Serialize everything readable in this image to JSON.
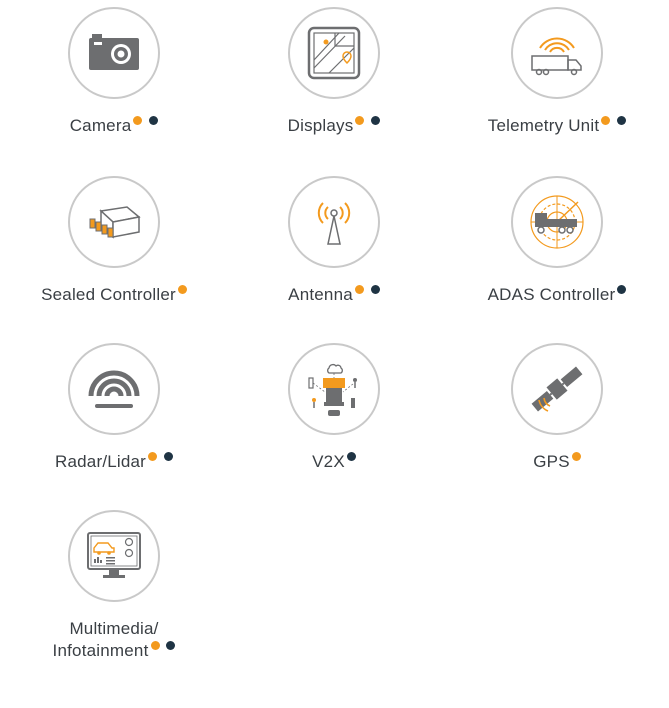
{
  "colors": {
    "orange": "#f39a1e",
    "navy": "#1f3444",
    "gray": "#6d6e70",
    "ring": "#c9c9c9"
  },
  "items": [
    {
      "label": "Camera",
      "icon": "camera-icon",
      "dots": [
        "orange",
        "navy"
      ]
    },
    {
      "label": "Displays",
      "icon": "map-display-icon",
      "dots": [
        "orange",
        "navy"
      ]
    },
    {
      "label": "Telemetry Unit",
      "icon": "telemetry-truck-icon",
      "dots": [
        "orange",
        "navy"
      ]
    },
    {
      "label": "Sealed Controller",
      "icon": "sealed-controller-icon",
      "dots": [
        "orange"
      ]
    },
    {
      "label": "Antenna",
      "icon": "antenna-icon",
      "dots": [
        "orange",
        "navy"
      ]
    },
    {
      "label": "ADAS Controller",
      "icon": "adas-truck-radar-icon",
      "dots": [
        "navy"
      ]
    },
    {
      "label": "Radar/Lidar",
      "icon": "radar-icon",
      "dots": [
        "orange",
        "navy"
      ]
    },
    {
      "label": "V2X",
      "icon": "v2x-icon",
      "dots": [
        "navy"
      ]
    },
    {
      "label": "GPS",
      "icon": "satellite-icon",
      "dots": [
        "orange"
      ]
    },
    {
      "label_line1": "Multimedia/",
      "label_line2": "Infotainment",
      "icon": "infotainment-monitor-icon",
      "dots": [
        "orange",
        "navy"
      ]
    }
  ]
}
